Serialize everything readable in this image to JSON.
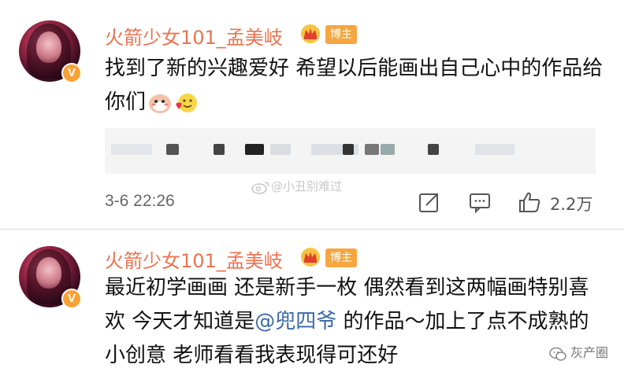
{
  "posts": [
    {
      "username": "火箭少女101_孟美岐",
      "tag": "博主",
      "verified_badge": "V",
      "content_text": "找到了新的兴趣爱好 希望以后能画出自己心中的作品给你们",
      "emojis": [
        "cute-face-emoji",
        "heart-face-emoji"
      ],
      "timestamp": "3-6 22:26",
      "like_count": "2.2万"
    },
    {
      "username": "火箭少女101_孟美岐",
      "tag": "博主",
      "verified_badge": "V",
      "content_before": "最近初学画画 还是新手一枚 偶然看到这两幅画特别喜欢 今天才知道是",
      "mention": "@兜四爷",
      "content_after": " 的作品～加上了点不成熟的小创意 老师看看我表现得可还好"
    }
  ],
  "watermark_center": "@小丑别难过",
  "watermark_corner": "灰产圈",
  "colors": {
    "username": "#eb7350",
    "tag": "#f5a640",
    "mention": "#3a6aa5",
    "vbadge": "#f7a234"
  }
}
